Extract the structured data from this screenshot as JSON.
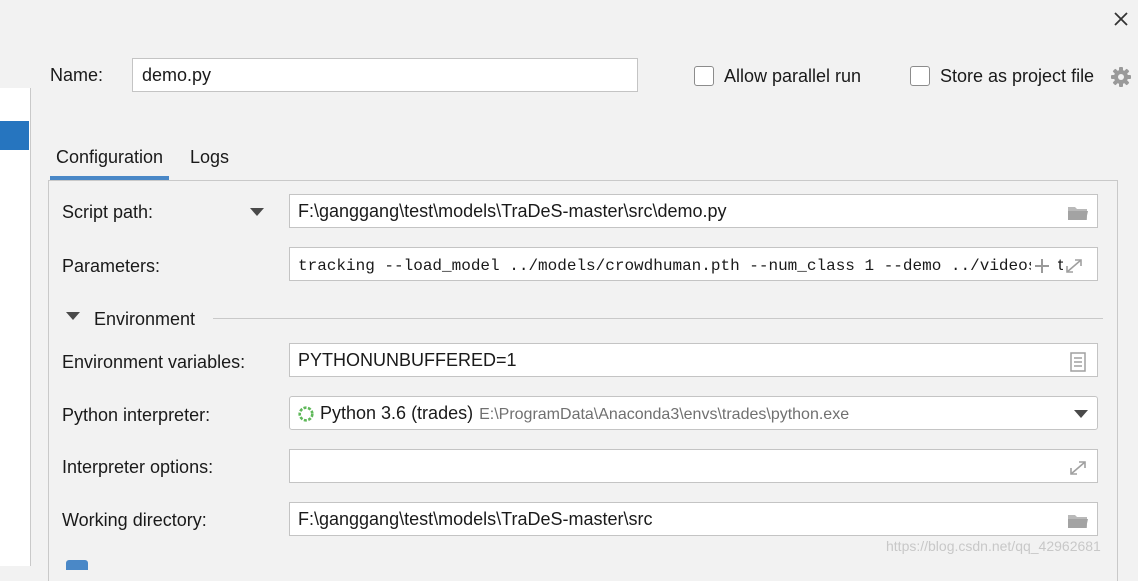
{
  "header": {
    "name_label": "Name:",
    "name_value": "demo.py",
    "allow_parallel_label": "Allow parallel run",
    "store_project_label": "Store as project file"
  },
  "tabs": [
    {
      "label": "Configuration",
      "active": true
    },
    {
      "label": "Logs",
      "active": false
    }
  ],
  "config": {
    "script_path_label": "Script path:",
    "script_path_value": "F:\\ganggang\\test\\models\\TraDeS-master\\src\\demo.py",
    "parameters_label": "Parameters:",
    "parameters_value": "tracking --load_model ../models/crowdhuman.pth --num_class 1 --demo ../videos/str",
    "environment_section": "Environment",
    "env_vars_label": "Environment variables:",
    "env_vars_value": "PYTHONUNBUFFERED=1",
    "interpreter_label": "Python interpreter:",
    "interpreter_name": "Python 3.6 (trades)",
    "interpreter_path": "E:\\ProgramData\\Anaconda3\\envs\\trades\\python.exe",
    "interp_options_label": "Interpreter options:",
    "interp_options_value": "",
    "working_dir_label": "Working directory:",
    "working_dir_value": "F:\\ganggang\\test\\models\\TraDeS-master\\src"
  },
  "watermark": "https://blog.csdn.net/qq_42962681",
  "icons": {
    "close": "close-icon",
    "settings": "gear-icon",
    "folder": "folder-icon",
    "expand": "expand-icon",
    "add": "plus-icon",
    "document": "document-icon",
    "spinner": "python-interpreter-icon"
  },
  "colors": {
    "accent": "#4a88c7",
    "selection": "#2675bf",
    "background": "#f2f2f2",
    "field_border": "#c4c4c4"
  }
}
